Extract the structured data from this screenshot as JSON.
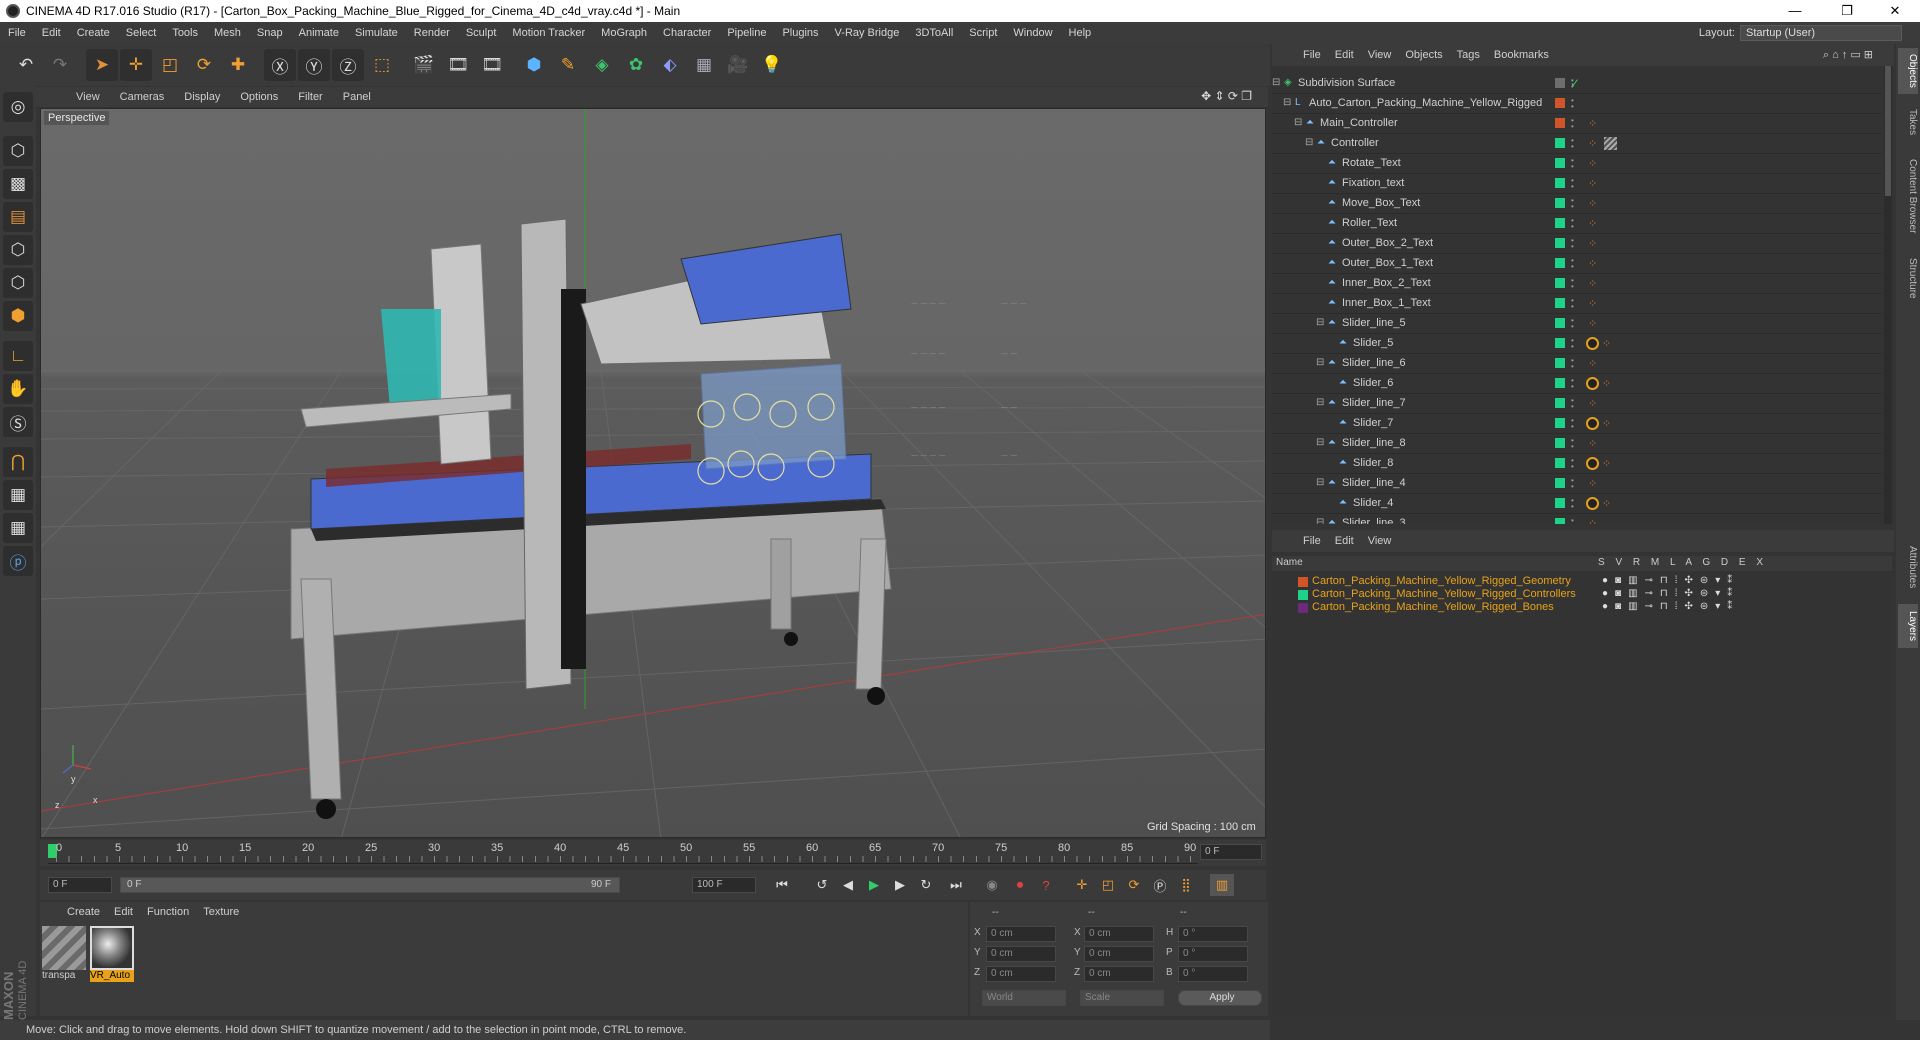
{
  "window": {
    "title": "CINEMA 4D R17.016 Studio (R17) - [Carton_Box_Packing_Machine_Blue_Rigged_for_Cinema_4D_c4d_vray.c4d *] - Main",
    "minimize": "—",
    "maximize": "❐",
    "close": "✕"
  },
  "menubar": {
    "items": [
      "File",
      "Edit",
      "Create",
      "Select",
      "Tools",
      "Mesh",
      "Snap",
      "Animate",
      "Simulate",
      "Render",
      "Sculpt",
      "Motion Tracker",
      "MoGraph",
      "Character",
      "Pipeline",
      "Plugins",
      "V-Ray Bridge",
      "3DToAll",
      "Script",
      "Window",
      "Help"
    ],
    "layout_label": "Layout:",
    "layout_value": "Startup (User)"
  },
  "viewport": {
    "menu": [
      "View",
      "Cameras",
      "Display",
      "Options",
      "Filter",
      "Panel"
    ],
    "label": "Perspective",
    "grid_spacing": "Grid Spacing : 100 cm",
    "axis_x": "x",
    "axis_y": "y",
    "axis_z": "z"
  },
  "timeline": {
    "ticks": [
      "0",
      "5",
      "10",
      "15",
      "20",
      "25",
      "30",
      "35",
      "40",
      "45",
      "50",
      "55",
      "60",
      "65",
      "70",
      "75",
      "80",
      "85",
      "90"
    ],
    "current_frame_field": "0 F",
    "start_field": "0 F",
    "range_start": "0 F",
    "range_end": "90 F",
    "end_field": "100 F"
  },
  "materials": {
    "menu": [
      "Create",
      "Edit",
      "Function",
      "Texture"
    ],
    "items": [
      {
        "label": "transpa",
        "selected": false
      },
      {
        "label": "VR_Auto",
        "selected": true
      }
    ]
  },
  "coordinates": {
    "header": [
      "--",
      "--",
      "--"
    ],
    "rows": [
      {
        "l1": "X",
        "v1": "0 cm",
        "l2": "X",
        "v2": "0 cm",
        "l3": "H",
        "v3": "0 °"
      },
      {
        "l1": "Y",
        "v1": "0 cm",
        "l2": "Y",
        "v2": "0 cm",
        "l3": "P",
        "v3": "0 °"
      },
      {
        "l1": "Z",
        "v1": "0 cm",
        "l2": "Z",
        "v2": "0 cm",
        "l3": "B",
        "v3": "0 °"
      }
    ],
    "world": "World",
    "scale": "Scale",
    "apply": "Apply"
  },
  "status": "Move: Click and drag to move elements. Hold down SHIFT to quantize movement / add to the selection in point mode, CTRL to remove.",
  "brand": {
    "maxon": "MAXON",
    "cinema": "CINEMA 4D"
  },
  "objects": {
    "menu": [
      "File",
      "Edit",
      "View",
      "Objects",
      "Tags",
      "Bookmarks"
    ],
    "rows": [
      {
        "name": "Subdivision Surface",
        "depth": 0,
        "color": "#6e6e6e",
        "tag": "check"
      },
      {
        "name": "Auto_Carton_Packing_Machine_Yellow_Rigged",
        "depth": 1,
        "color": "#d2552a",
        "tag": ""
      },
      {
        "name": "Main_Controller",
        "depth": 2,
        "color": "#d2552a",
        "tag": "dots"
      },
      {
        "name": "Controller",
        "depth": 3,
        "color": "#1fd28a",
        "tag": "dots2"
      },
      {
        "name": "Rotate_Text",
        "depth": 4,
        "color": "#1fd28a",
        "tag": "dots"
      },
      {
        "name": "Fixation_text",
        "depth": 4,
        "color": "#1fd28a",
        "tag": "dots"
      },
      {
        "name": "Move_Box_Text",
        "depth": 4,
        "color": "#1fd28a",
        "tag": "dots"
      },
      {
        "name": "Roller_Text",
        "depth": 4,
        "color": "#1fd28a",
        "tag": "dots"
      },
      {
        "name": "Outer_Box_2_Text",
        "depth": 4,
        "color": "#1fd28a",
        "tag": "dots"
      },
      {
        "name": "Outer_Box_1_Text",
        "depth": 4,
        "color": "#1fd28a",
        "tag": "dots"
      },
      {
        "name": "Inner_Box_2_Text",
        "depth": 4,
        "color": "#1fd28a",
        "tag": "dots"
      },
      {
        "name": "Inner_Box_1_Text",
        "depth": 4,
        "color": "#1fd28a",
        "tag": "dots"
      },
      {
        "name": "Slider_line_5",
        "depth": 4,
        "color": "#1fd28a",
        "tag": "dots"
      },
      {
        "name": "Slider_5",
        "depth": 5,
        "color": "#1fd28a",
        "tag": "x"
      },
      {
        "name": "Slider_line_6",
        "depth": 4,
        "color": "#1fd28a",
        "tag": "dots"
      },
      {
        "name": "Slider_6",
        "depth": 5,
        "color": "#1fd28a",
        "tag": "x"
      },
      {
        "name": "Slider_line_7",
        "depth": 4,
        "color": "#1fd28a",
        "tag": "dots"
      },
      {
        "name": "Slider_7",
        "depth": 5,
        "color": "#1fd28a",
        "tag": "x"
      },
      {
        "name": "Slider_line_8",
        "depth": 4,
        "color": "#1fd28a",
        "tag": "dots"
      },
      {
        "name": "Slider_8",
        "depth": 5,
        "color": "#1fd28a",
        "tag": "x"
      },
      {
        "name": "Slider_line_4",
        "depth": 4,
        "color": "#1fd28a",
        "tag": "dots"
      },
      {
        "name": "Slider_4",
        "depth": 5,
        "color": "#1fd28a",
        "tag": "x"
      },
      {
        "name": "Slider_line_3",
        "depth": 4,
        "color": "#1fd28a",
        "tag": "dots"
      }
    ]
  },
  "layers": {
    "menu": [
      "File",
      "Edit",
      "View"
    ],
    "header_name": "Name",
    "header_cols": "S V R M L A G D E X",
    "rows": [
      {
        "name": "Carton_Packing_Machine_Yellow_Rigged_Geometry",
        "color": "#d2552a"
      },
      {
        "name": "Carton_Packing_Machine_Yellow_Rigged_Controllers",
        "color": "#1fd28a"
      },
      {
        "name": "Carton_Packing_Machine_Yellow_Rigged_Bones",
        "color": "#6b2a7a"
      }
    ]
  },
  "right_tabs": [
    "Objects",
    "Takes",
    "Content Browser",
    "Structure",
    "Attributes",
    "Layers"
  ]
}
